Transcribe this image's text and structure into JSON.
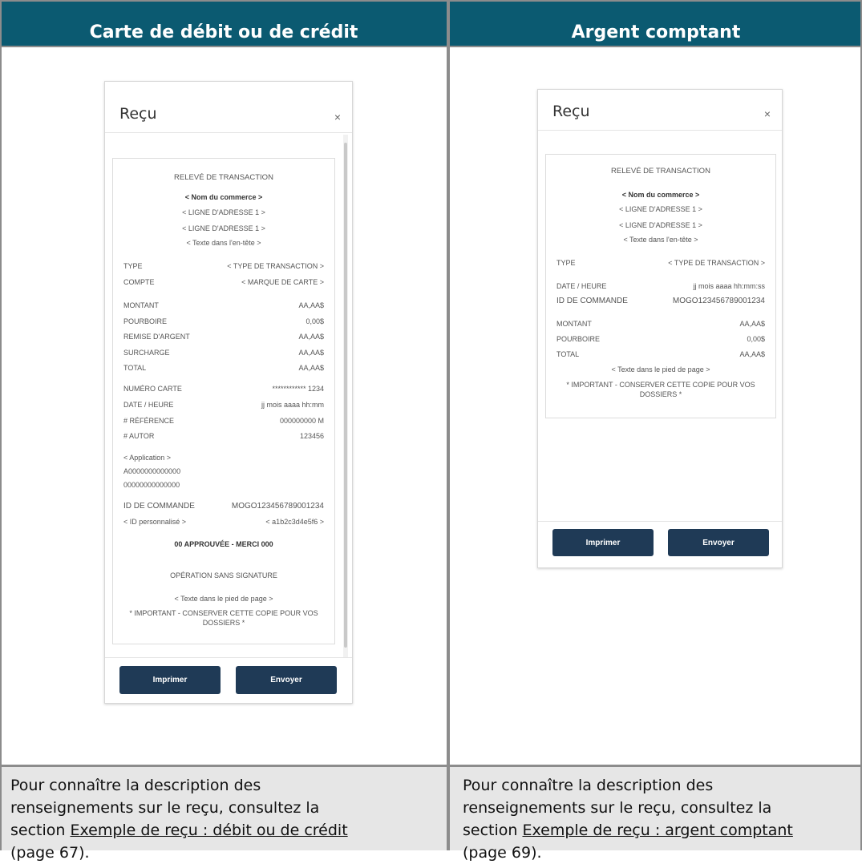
{
  "headers": {
    "left": "Carte de débit ou de crédit",
    "right": "Argent comptant"
  },
  "footers": {
    "left": {
      "line1": "Pour connaître la description des",
      "line2": "renseignements sur le reçu, consultez la",
      "prefix": "section ",
      "link": "Exemple de reçu : débit ou de crédit",
      "suffix": "(page 67)."
    },
    "right": {
      "line1": "Pour connaître la description des",
      "line2": "renseignements sur le reçu, consultez la",
      "prefix": "section ",
      "link": "Exemple de reçu : argent comptant",
      "suffix": "(page 69)."
    }
  },
  "left_modal": {
    "title": "Reçu",
    "close": "×",
    "receipt": {
      "title": "RELEVÉ DE TRANSACTION",
      "merchant": "< Nom du commerce >",
      "address1": "< LIGNE D'ADRESSE  1 >",
      "address2": "< LIGNE D'ADRESSE  1 >",
      "header_text": "< Texte dans l'en-tête >",
      "rows": [
        {
          "label": "TYPE",
          "value": "< TYPE DE TRANSACTION >"
        },
        {
          "label": "COMPTE",
          "value": "< MARQUE DE CARTE >"
        },
        {
          "label": "MONTANT",
          "value": "AA,AA$"
        },
        {
          "label": "POURBOIRE",
          "value": "0,00$"
        },
        {
          "label": "REMISE D'ARGENT",
          "value": "AA,AA$"
        },
        {
          "label": "SURCHARGE",
          "value": "AA,AA$"
        },
        {
          "label": "TOTAL",
          "value": "AA,AA$"
        },
        {
          "label": "NUMÉRO CARTE",
          "value": "************ 1234"
        },
        {
          "label": "DATE / HEURE",
          "value": "jj mois aaaa hh:mm"
        },
        {
          "label": "# RÉFÉRENCE",
          "value": "000000000 M"
        },
        {
          "label": "# AUTOR",
          "value": "123456"
        }
      ],
      "application": "< Application >",
      "aid1": "A0000000000000",
      "aid2": "00000000000000",
      "order_label": "ID DE COMMANDE",
      "order_value": "MOGO123456789001234",
      "custom_label": "< ID personnalisé >",
      "custom_value": "< a1b2c3d4e5f6 >",
      "approved": "00 APPROUVÉE - MERCI 000",
      "no_signature": "OPÉRATION SANS SIGNATURE",
      "footer_text": "< Texte dans le pied de page >",
      "important1": "* IMPORTANT - CONSERVER CETTE COPIE POUR VOS",
      "important2": "DOSSIERS *"
    },
    "print": "Imprimer",
    "send": "Envoyer"
  },
  "right_modal": {
    "title": "Reçu",
    "close": "×",
    "receipt": {
      "title": "RELEVÉ DE TRANSACTION",
      "merchant": "< Nom du commerce >",
      "address1": "< LIGNE D'ADRESSE  1 >",
      "address2": "< LIGNE D'ADRESSE  1 >",
      "header_text": "< Texte dans l'en-tête >",
      "rows": [
        {
          "label": "TYPE",
          "value": "< TYPE DE TRANSACTION >"
        },
        {
          "label": "DATE / HEURE",
          "value": "jj mois aaaa hh:mm:ss"
        },
        {
          "label": "ID DE COMMANDE",
          "value": "MOGO123456789001234"
        },
        {
          "label": "MONTANT",
          "value": "AA,AA$"
        },
        {
          "label": "POURBOIRE",
          "value": "0,00$"
        },
        {
          "label": "TOTAL",
          "value": "AA,AA$"
        }
      ],
      "footer_text": "< Texte dans le pied de page >",
      "important1": "* IMPORTANT - CONSERVER CETTE COPIE POUR VOS",
      "important2": "DOSSIERS *"
    },
    "print": "Imprimer",
    "send": "Envoyer"
  }
}
